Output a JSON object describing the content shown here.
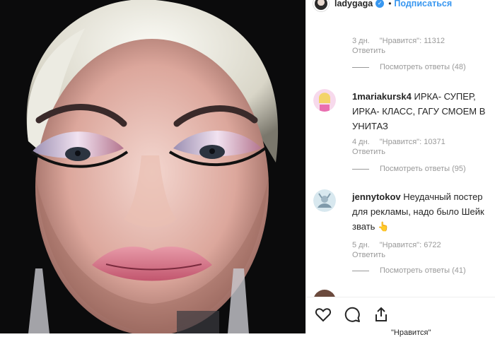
{
  "header": {
    "username": "ladygaga",
    "follow_label": "Подписаться",
    "separator": "•"
  },
  "comments": [
    {
      "username": "",
      "text": "",
      "time": "3 дн.",
      "likes_text": "\"Нравится\": 11312",
      "reply_label": "Ответить",
      "view_replies": "Посмотреть ответы (48)"
    },
    {
      "username": "1mariakursk4",
      "text": "ИРКА- СУПЕР, ИРКА- КЛАСС, ГАГУ СМОЕМ В УНИТАЗ",
      "time": "4 дн.",
      "likes_text": "\"Нравится\": 10371",
      "reply_label": "Ответить",
      "view_replies": "Посмотреть ответы (95)"
    },
    {
      "username": "jennytokov",
      "text": "Неудачный постер для рекламы, надо было Шейк звать 👆",
      "time": "5 дн.",
      "likes_text": "\"Нравится\": 6722",
      "reply_label": "Ответить",
      "view_replies": "Посмотреть ответы (41)"
    }
  ],
  "actions": {
    "like_icon": "heart-icon",
    "comment_icon": "comment-icon",
    "share_icon": "share-icon"
  },
  "footer": {
    "likes_partial": "\"Нравится\""
  }
}
